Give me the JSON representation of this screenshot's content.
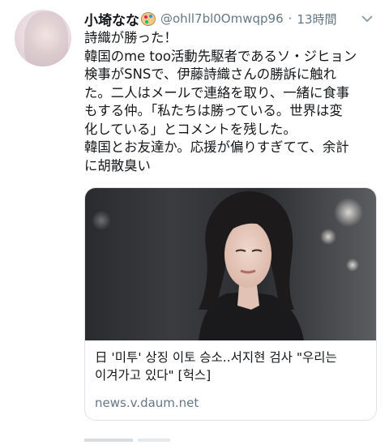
{
  "tweet": {
    "display_name": "小埼なな",
    "handle": "@ohll7bl0Omwqp96",
    "separator": "·",
    "time": "13時間",
    "body_lines": [
      "詩織が勝った！",
      "韓国のme too活動先駆者であるソ・ジヒョン",
      "検事がSNSで、伊藤詩織さんの勝訴に触れ",
      "た。二人はメールで連絡を取り、一緒に食事",
      "もする仲。「私たちは勝っている。世界は変",
      "化している」とコメントを残した。",
      "韓国とお友達か。応援が偏りすぎてて、余計",
      "に胡散臭い"
    ]
  },
  "link_card": {
    "title_line1": "日 '미투' 상징 이토 승소..서지현 검사 \"우리는",
    "title_line2": "이겨가고 있다\" [헉스]",
    "domain": "news.v.daum.net"
  },
  "icons": {
    "more": "chevron-down-icon",
    "name_emoji": "palette-icon"
  },
  "colors": {
    "text_primary": "#14171a",
    "text_secondary": "#657786",
    "card_border": "#dde3e8"
  }
}
